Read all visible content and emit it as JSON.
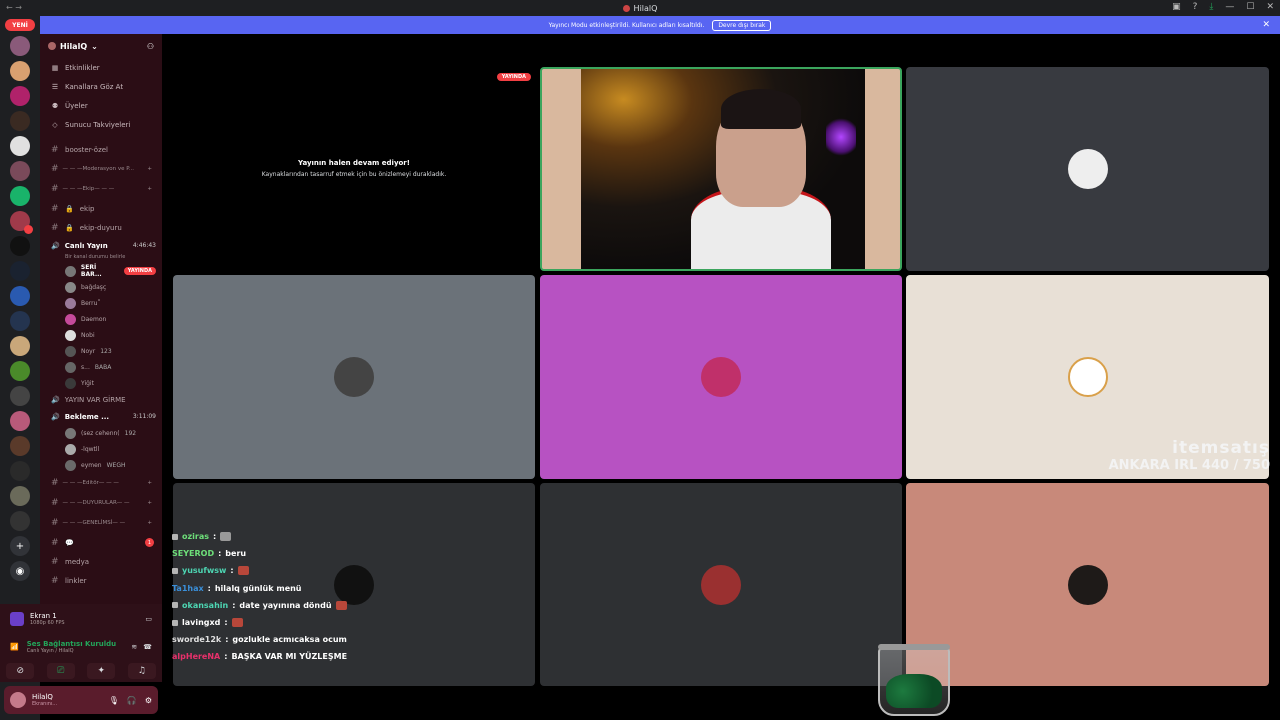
{
  "window": {
    "title": "HilalQ"
  },
  "banner": {
    "text": "Yayıncı Modu etkinleştirildi. Kullanıcı adları kısaltıldı.",
    "button": "Devre dışı bırak"
  },
  "guild_bar": {
    "new_badge": "YENİ"
  },
  "server": {
    "name": "HilalQ",
    "menu": [
      "Etkinlikler",
      "Kanallara Göz At",
      "Üyeler",
      "Sunucu Takviyeleri"
    ],
    "channels": {
      "booster": "booster-özel",
      "cat_mod": "— — —Moderasyon ve P...",
      "cat_ekip": "— — —Ekip— — —",
      "ekip": "ekip",
      "ekip_duyuru": "ekip-duyuru",
      "voice_live": "Canlı Yayın",
      "voice_live_time": "4:46:43",
      "voice_live_sub": "Bir kanal durumu belirle",
      "voice_nolive": "YAYIN VAR GİRME",
      "voice_wait": "Bekleme ...",
      "voice_wait_time": "3:11:09",
      "cat_editor": "— — —Editör— — —",
      "cat_duyuru": "— — —DUYURULAR— —",
      "cat_genel": "— — —GENELİMSİ— —",
      "medya": "medya",
      "linkler": "linkler",
      "unread_count": "1"
    },
    "live_members": [
      {
        "name": "SERİ BAR...",
        "badge": "YAYINDA"
      },
      {
        "name": "bağdaşç"
      },
      {
        "name": "Berru˚"
      },
      {
        "name": "Daemon"
      },
      {
        "name": "Nobi"
      },
      {
        "name": "Noyr",
        "tag": "123"
      },
      {
        "name": "s...",
        "tag": "BABA"
      },
      {
        "name": "Yiğit"
      }
    ],
    "wait_members": [
      {
        "name": "(sez cehenn(",
        "tag": "192"
      },
      {
        "name": "-lqwtll"
      },
      {
        "name": "eymen",
        "tag": "WEGH"
      }
    ]
  },
  "screen_panel": {
    "title": "Ekran 1",
    "sub": "1080p 60 FPS"
  },
  "conn_panel": {
    "title": "Ses Bağlantısı Kuruldu",
    "sub": "Canlı Yayın / HilalQ"
  },
  "user_panel": {
    "name": "HilalQ",
    "status": "Ekranını..."
  },
  "stream": {
    "live_badge": "YAYINDA",
    "msg_title": "Yayının halen devam ediyor!",
    "msg_body": "Kaynaklarından tasarruf etmek için bu önizlemeyi durakladık."
  },
  "overlay": {
    "brand": "itemsatış",
    "goal": "ANKARA IRL 440 / 750"
  },
  "chat": [
    {
      "user": "oziras",
      "color": "#6ee07a",
      "msg": ""
    },
    {
      "user": "SEYEROD",
      "color": "#6ee07a",
      "msg": "beru"
    },
    {
      "user": "yusufwsw",
      "color": "#4dd6b3",
      "msg": ""
    },
    {
      "user": "Ta1hax",
      "color": "#3a8fd9",
      "msg": "hilalq günlük menü"
    },
    {
      "user": "okansahin",
      "color": "#4dd6b3",
      "msg": "date yayınına döndü"
    },
    {
      "user": "lavingxd",
      "color": "#ffffff",
      "msg": ""
    },
    {
      "user": "sworde12k",
      "color": "#e0e0e0",
      "msg": "gozlukle acmıcaksa ocum"
    },
    {
      "user": "alpHereNA",
      "color": "#e8306b",
      "msg": "BAŞKA VAR MI YÜZLEŞME"
    }
  ],
  "colors": {
    "accent": "#5865f2",
    "live": "#f23f43",
    "online": "#23a55a",
    "tile_gray": "#383a40",
    "tile_slate": "#6b7279",
    "tile_magenta": "#b752c2",
    "tile_cream": "#e8e0d6",
    "tile_dark": "#2e3033",
    "tile_salmon": "#c8897a"
  }
}
